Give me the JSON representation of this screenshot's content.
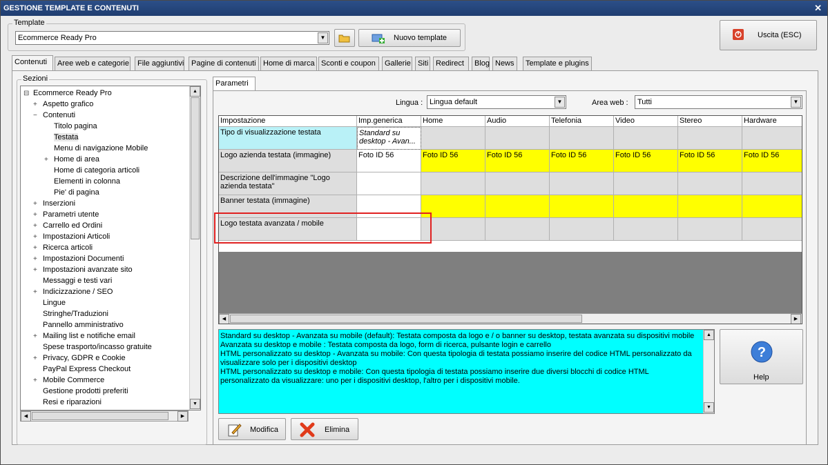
{
  "window": {
    "title": "GESTIONE TEMPLATE E CONTENUTI",
    "close": "✕"
  },
  "template_group": {
    "title": "Template",
    "selected": "Ecommerce Ready Pro",
    "new_template_label": "Nuovo template"
  },
  "exit_label": "Uscita (ESC)",
  "tabs": [
    "Contenuti",
    "Aree web e categorie",
    "File aggiuntivi",
    "Pagine di contenuti",
    "Home di marca",
    "Sconti e coupon",
    "Gallerie",
    "Siti",
    "Redirect",
    "Blog",
    "News",
    "Template e plugins"
  ],
  "sections": {
    "title": "Sezioni",
    "tree": [
      {
        "label": "Ecommerce Ready Pro",
        "toggle": "⊟",
        "level": 0
      },
      {
        "label": "Aspetto grafico",
        "toggle": "+",
        "level": 1
      },
      {
        "label": "Contenuti",
        "toggle": "−",
        "level": 1
      },
      {
        "label": "Titolo pagina",
        "toggle": "",
        "level": 2
      },
      {
        "label": "Testata",
        "toggle": "",
        "level": 2,
        "selected": true
      },
      {
        "label": "Menu di navigazione Mobile",
        "toggle": "",
        "level": 2
      },
      {
        "label": "Home di area",
        "toggle": "+",
        "level": 2
      },
      {
        "label": "Home di categoria articoli",
        "toggle": "",
        "level": 2
      },
      {
        "label": "Elementi in colonna",
        "toggle": "",
        "level": 2
      },
      {
        "label": "Pie' di pagina",
        "toggle": "",
        "level": 2
      },
      {
        "label": "Inserzioni",
        "toggle": "+",
        "level": 1
      },
      {
        "label": "Parametri utente",
        "toggle": "+",
        "level": 1
      },
      {
        "label": "Carrello ed Ordini",
        "toggle": "+",
        "level": 1
      },
      {
        "label": "Impostazioni Articoli",
        "toggle": "+",
        "level": 1
      },
      {
        "label": "Ricerca articoli",
        "toggle": "+",
        "level": 1
      },
      {
        "label": "Impostazioni Documenti",
        "toggle": "+",
        "level": 1
      },
      {
        "label": "Impostazioni avanzate sito",
        "toggle": "+",
        "level": 1
      },
      {
        "label": "Messaggi e testi vari",
        "toggle": "",
        "level": 1
      },
      {
        "label": "Indicizzazione / SEO",
        "toggle": "+",
        "level": 1
      },
      {
        "label": "Lingue",
        "toggle": "",
        "level": 1
      },
      {
        "label": "Stringhe/Traduzioni",
        "toggle": "",
        "level": 1
      },
      {
        "label": "Pannello amministrativo",
        "toggle": "",
        "level": 1
      },
      {
        "label": "Mailing list e notifiche email",
        "toggle": "+",
        "level": 1
      },
      {
        "label": "Spese trasporto/incasso gratuite",
        "toggle": "",
        "level": 1
      },
      {
        "label": "Privacy, GDPR e Cookie",
        "toggle": "+",
        "level": 1
      },
      {
        "label": "PayPal Express Checkout",
        "toggle": "",
        "level": 1
      },
      {
        "label": "Mobile Commerce",
        "toggle": "+",
        "level": 1
      },
      {
        "label": "Gestione prodotti preferiti",
        "toggle": "",
        "level": 1
      },
      {
        "label": "Resi e riparazioni",
        "toggle": "",
        "level": 1
      }
    ]
  },
  "params": {
    "tab": "Parametri",
    "lingua_label": "Lingua :",
    "lingua_value": "Lingua default",
    "area_label": "Area web :",
    "area_value": "Tutti"
  },
  "grid": {
    "columns": [
      "Impostazione",
      "Imp.generica",
      "Home",
      "Audio",
      "Telefonia",
      "Video",
      "Stereo",
      "Hardware"
    ],
    "rows": [
      {
        "name": "Tipo di visualizzazione testata",
        "generic": "Standard su desktop - Avan...",
        "values": [
          "",
          "",
          "",
          "",
          "",
          ""
        ],
        "style": "cyan"
      },
      {
        "name": "Logo azienda testata (immagine)",
        "generic": "Foto ID 56",
        "values": [
          "Foto ID 56",
          "Foto ID 56",
          "Foto ID 56",
          "Foto ID 56",
          "Foto ID 56",
          "Foto ID 56"
        ],
        "style": "yellow"
      },
      {
        "name": "Descrizione dell'immagine \"Logo azienda testata\"",
        "generic": "",
        "values": [
          "",
          "",
          "",
          "",
          "",
          ""
        ],
        "style": "gray"
      },
      {
        "name": "Banner testata (immagine)",
        "generic": "",
        "values": [
          "",
          "",
          "",
          "",
          "",
          ""
        ],
        "style": "yellow"
      },
      {
        "name": "Logo testata avanzata / mobile",
        "generic": "",
        "values": [
          "",
          "",
          "",
          "",
          "",
          ""
        ],
        "style": "gray"
      }
    ]
  },
  "description": [
    "Standard su desktop - Avanzata su mobile (default): Testata composta da logo e / o banner su desktop, testata avanzata su dispositivi mobile",
    "Avanzata su desktop e mobile : Testata composta da logo, form di ricerca, pulsante login e carrello",
    "HTML personalizzato su desktop - Avanzata su mobile: Con questa tipologia di testata possiamo inserire del codice HTML personalizzato da visualizzare solo per i dispositivi desktop",
    "HTML personalizzato su desktop e mobile: Con questa tipologia di testata possiamo inserire due diversi blocchi di codice HTML personalizzato da visualizzare: uno per i dispositivi desktop, l'altro per i dispositivi mobile."
  ],
  "buttons": {
    "help": "Help",
    "modify": "Modifica",
    "delete": "Elimina"
  },
  "colors": {
    "cyan": "#b9f1f7",
    "yellow": "#ffff00",
    "gray": "#dedede",
    "desc_bg": "#00ffff"
  }
}
